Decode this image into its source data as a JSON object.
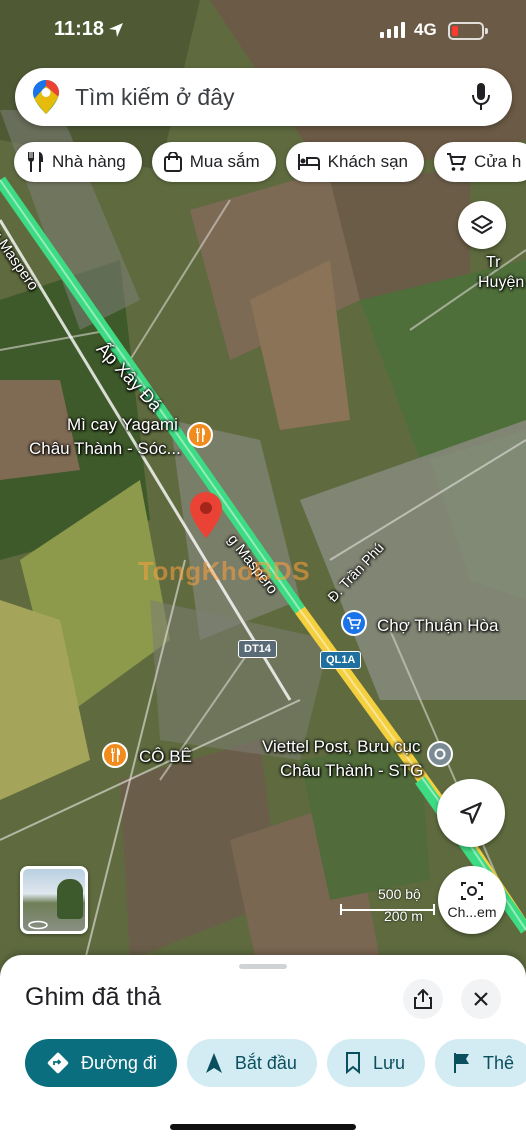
{
  "status_bar": {
    "time": "11:18",
    "network": "4G"
  },
  "search": {
    "placeholder": "Tìm kiếm ở đây"
  },
  "chips": [
    {
      "label": "Nhà hàng",
      "icon": "fork-knife-icon"
    },
    {
      "label": "Mua sắm",
      "icon": "shopping-bag-icon"
    },
    {
      "label": "Khách sạn",
      "icon": "bed-icon"
    },
    {
      "label": "Cửa h",
      "icon": "cart-icon"
    }
  ],
  "map": {
    "labels": {
      "road_ap_xay_da": "Ấp Xây Đá",
      "road_maspero_top": "ng Maspero",
      "road_maspero_mid": "g Maspero",
      "road_tran_phu": "Đ. Trần Phú",
      "poi_yagami_1": "Mì cay Yagami",
      "poi_yagami_2": "Châu Thành - Sóc...",
      "poi_cho": "Chợ Thuận Hòa",
      "poi_cobe": "CÔ BÊ",
      "poi_viettel_1": "Viettel Post, Bưu cục",
      "poi_viettel_2": "Châu Thành - STG",
      "area_tr": "Tr",
      "area_huyen": "Huyện",
      "shield_dt14": "DT14",
      "shield_ql1a": "QL1A",
      "watermark": "TongKhoBDS"
    },
    "scale": {
      "imperial": "500 bộ",
      "metric": "200 m"
    },
    "lens_label": "Ch...em"
  },
  "sheet": {
    "title": "Ghim đã thả",
    "actions": [
      {
        "label": "Đường đi",
        "icon": "directions-icon"
      },
      {
        "label": "Bắt đầu",
        "icon": "navigation-arrow-icon"
      },
      {
        "label": "Lưu",
        "icon": "bookmark-icon"
      },
      {
        "label": "Thê",
        "icon": "flag-icon"
      }
    ]
  },
  "colors": {
    "primary_action": "#0b6e7e",
    "secondary_action": "#d3ecf3",
    "pin_red": "#ea4335",
    "road_green": "#3ddc84",
    "road_yellow": "#f4d03f",
    "food_poi": "#f28b1e",
    "shop_poi": "#1a73e8"
  }
}
